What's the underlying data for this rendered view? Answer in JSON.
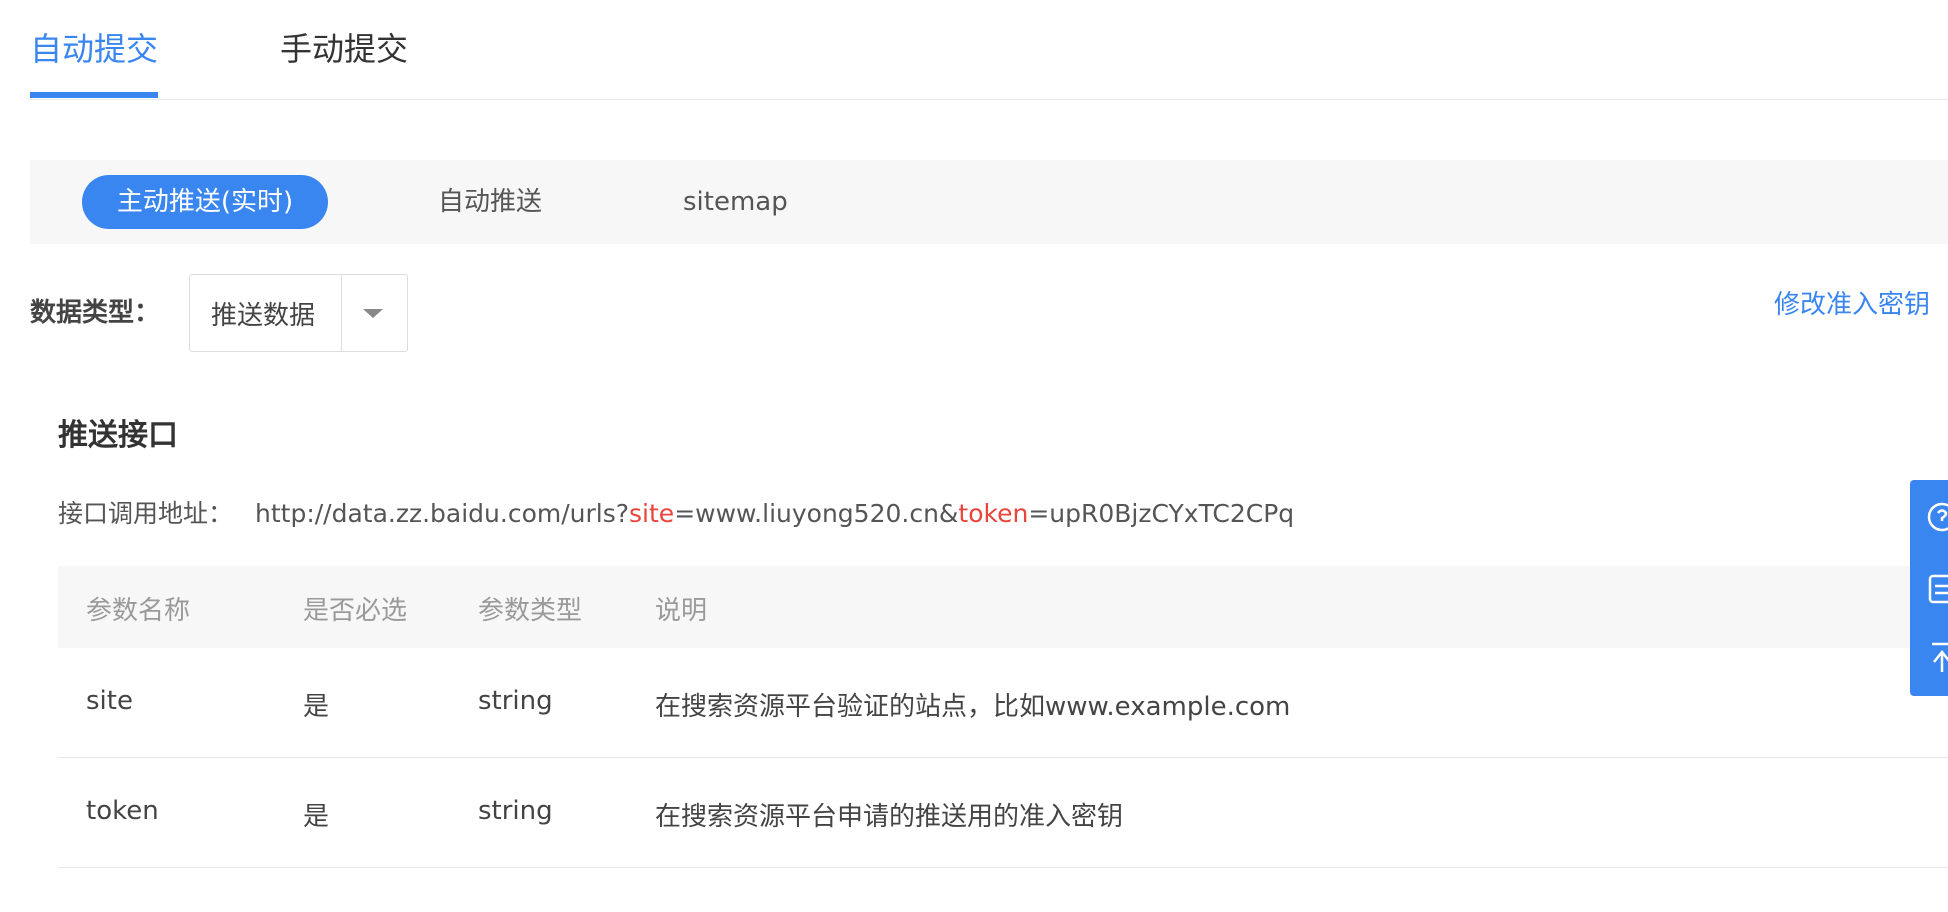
{
  "main_tabs": [
    "自动提交",
    "手动提交"
  ],
  "sub_tabs": [
    "主动推送(实时)",
    "自动推送",
    "sitemap"
  ],
  "data_type": {
    "label": "数据类型：",
    "selected": "推送数据"
  },
  "modify_key_link": "修改准入密钥",
  "push_api": {
    "title": "推送接口",
    "endpoint_label": "接口调用地址：",
    "url_prefix": "http://data.zz.baidu.com/urls?",
    "param_site": "site",
    "site_value": "=www.liuyong520.cn&",
    "param_token": "token",
    "token_value": "=upR0BjzCYxTC2CPq"
  },
  "params_table": {
    "headers": [
      "参数名称",
      "是否必选",
      "参数类型",
      "说明"
    ],
    "rows": [
      [
        "site",
        "是",
        "string",
        "在搜索资源平台验证的站点，比如www.example.com"
      ],
      [
        "token",
        "是",
        "string",
        "在搜索资源平台申请的推送用的准入密钥"
      ]
    ]
  },
  "colors": {
    "accent": "#3a86f0",
    "param_highlight": "#e8443c",
    "subnav_bg": "#f7f7f7"
  },
  "float_tools": [
    "help-icon",
    "document-icon",
    "back-to-top-icon"
  ]
}
